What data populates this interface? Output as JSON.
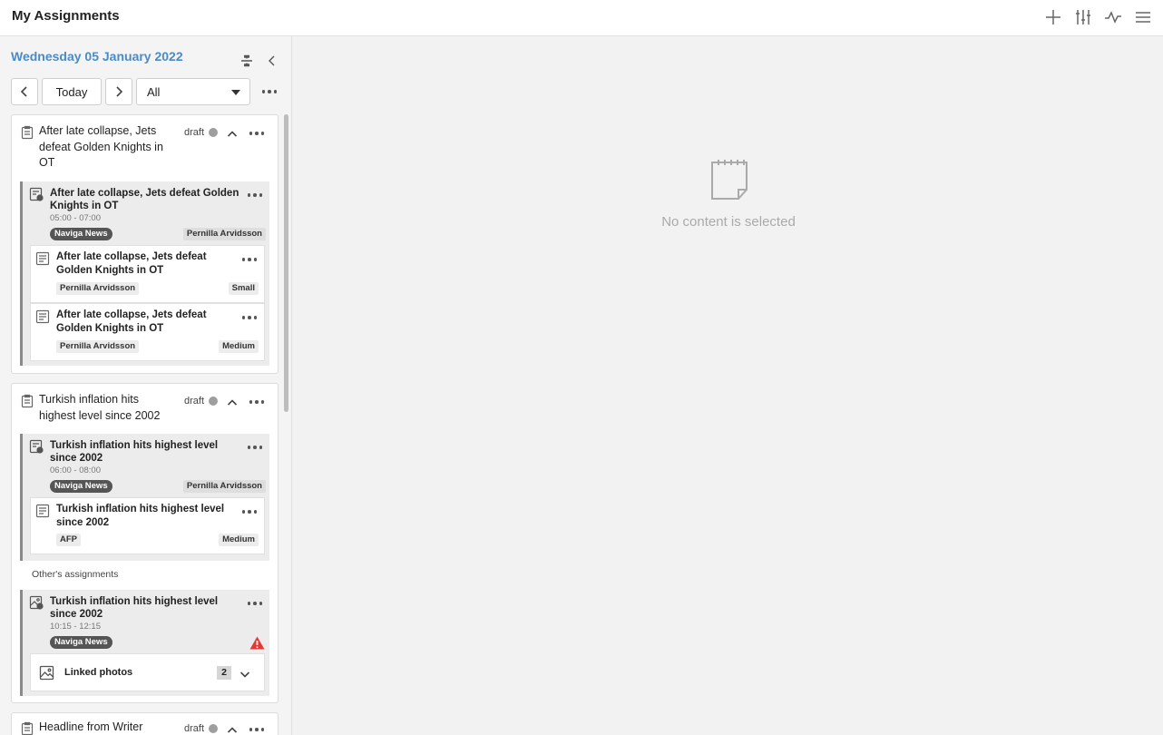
{
  "app": {
    "title": "My Assignments"
  },
  "toolbar": {
    "icons": [
      "plus-icon",
      "sliders-icon",
      "activity-icon",
      "hamburger-menu-icon"
    ]
  },
  "left_panel": {
    "date": "Wednesday 05 January 2022",
    "nav": {
      "today_label": "Today",
      "filter_value": "All"
    }
  },
  "cards": [
    {
      "title": "After late collapse, Jets defeat Golden Knights in OT",
      "status": "draft",
      "planning": {
        "title": "After late collapse, Jets defeat Golden Knights in OT",
        "time": "05:00 - 07:00",
        "section": "Naviga News",
        "assignee": "Pernilla Arvidsson",
        "articles": [
          {
            "title": "After late collapse, Jets defeat Golden Knights in OT",
            "author": "Pernilla Arvidsson",
            "size": "Small"
          },
          {
            "title": "After late collapse, Jets defeat Golden Knights in OT",
            "author": "Pernilla Arvidsson",
            "size": "Medium"
          }
        ]
      }
    },
    {
      "title": "Turkish inflation hits highest level since 2002",
      "status": "draft",
      "planning": {
        "title": "Turkish inflation hits highest level since 2002",
        "time": "06:00 - 08:00",
        "section": "Naviga News",
        "assignee": "Pernilla Arvidsson",
        "articles": [
          {
            "title": "Turkish inflation hits highest level since 2002",
            "author": "AFP",
            "size": "Medium"
          }
        ]
      },
      "others_label": "Other's assignments",
      "other_assignment": {
        "title": "Turkish inflation hits highest level since 2002",
        "time": "10:15 - 12:15",
        "section": "Naviga News",
        "linked_label": "Linked photos",
        "linked_count": "2"
      }
    },
    {
      "title": "Headline from Writer",
      "status": "draft"
    }
  ],
  "empty_state": {
    "text": "No content is selected"
  },
  "colors": {
    "accent": "#4a8bc7",
    "warning": "#e53935",
    "badge": "#555555"
  }
}
